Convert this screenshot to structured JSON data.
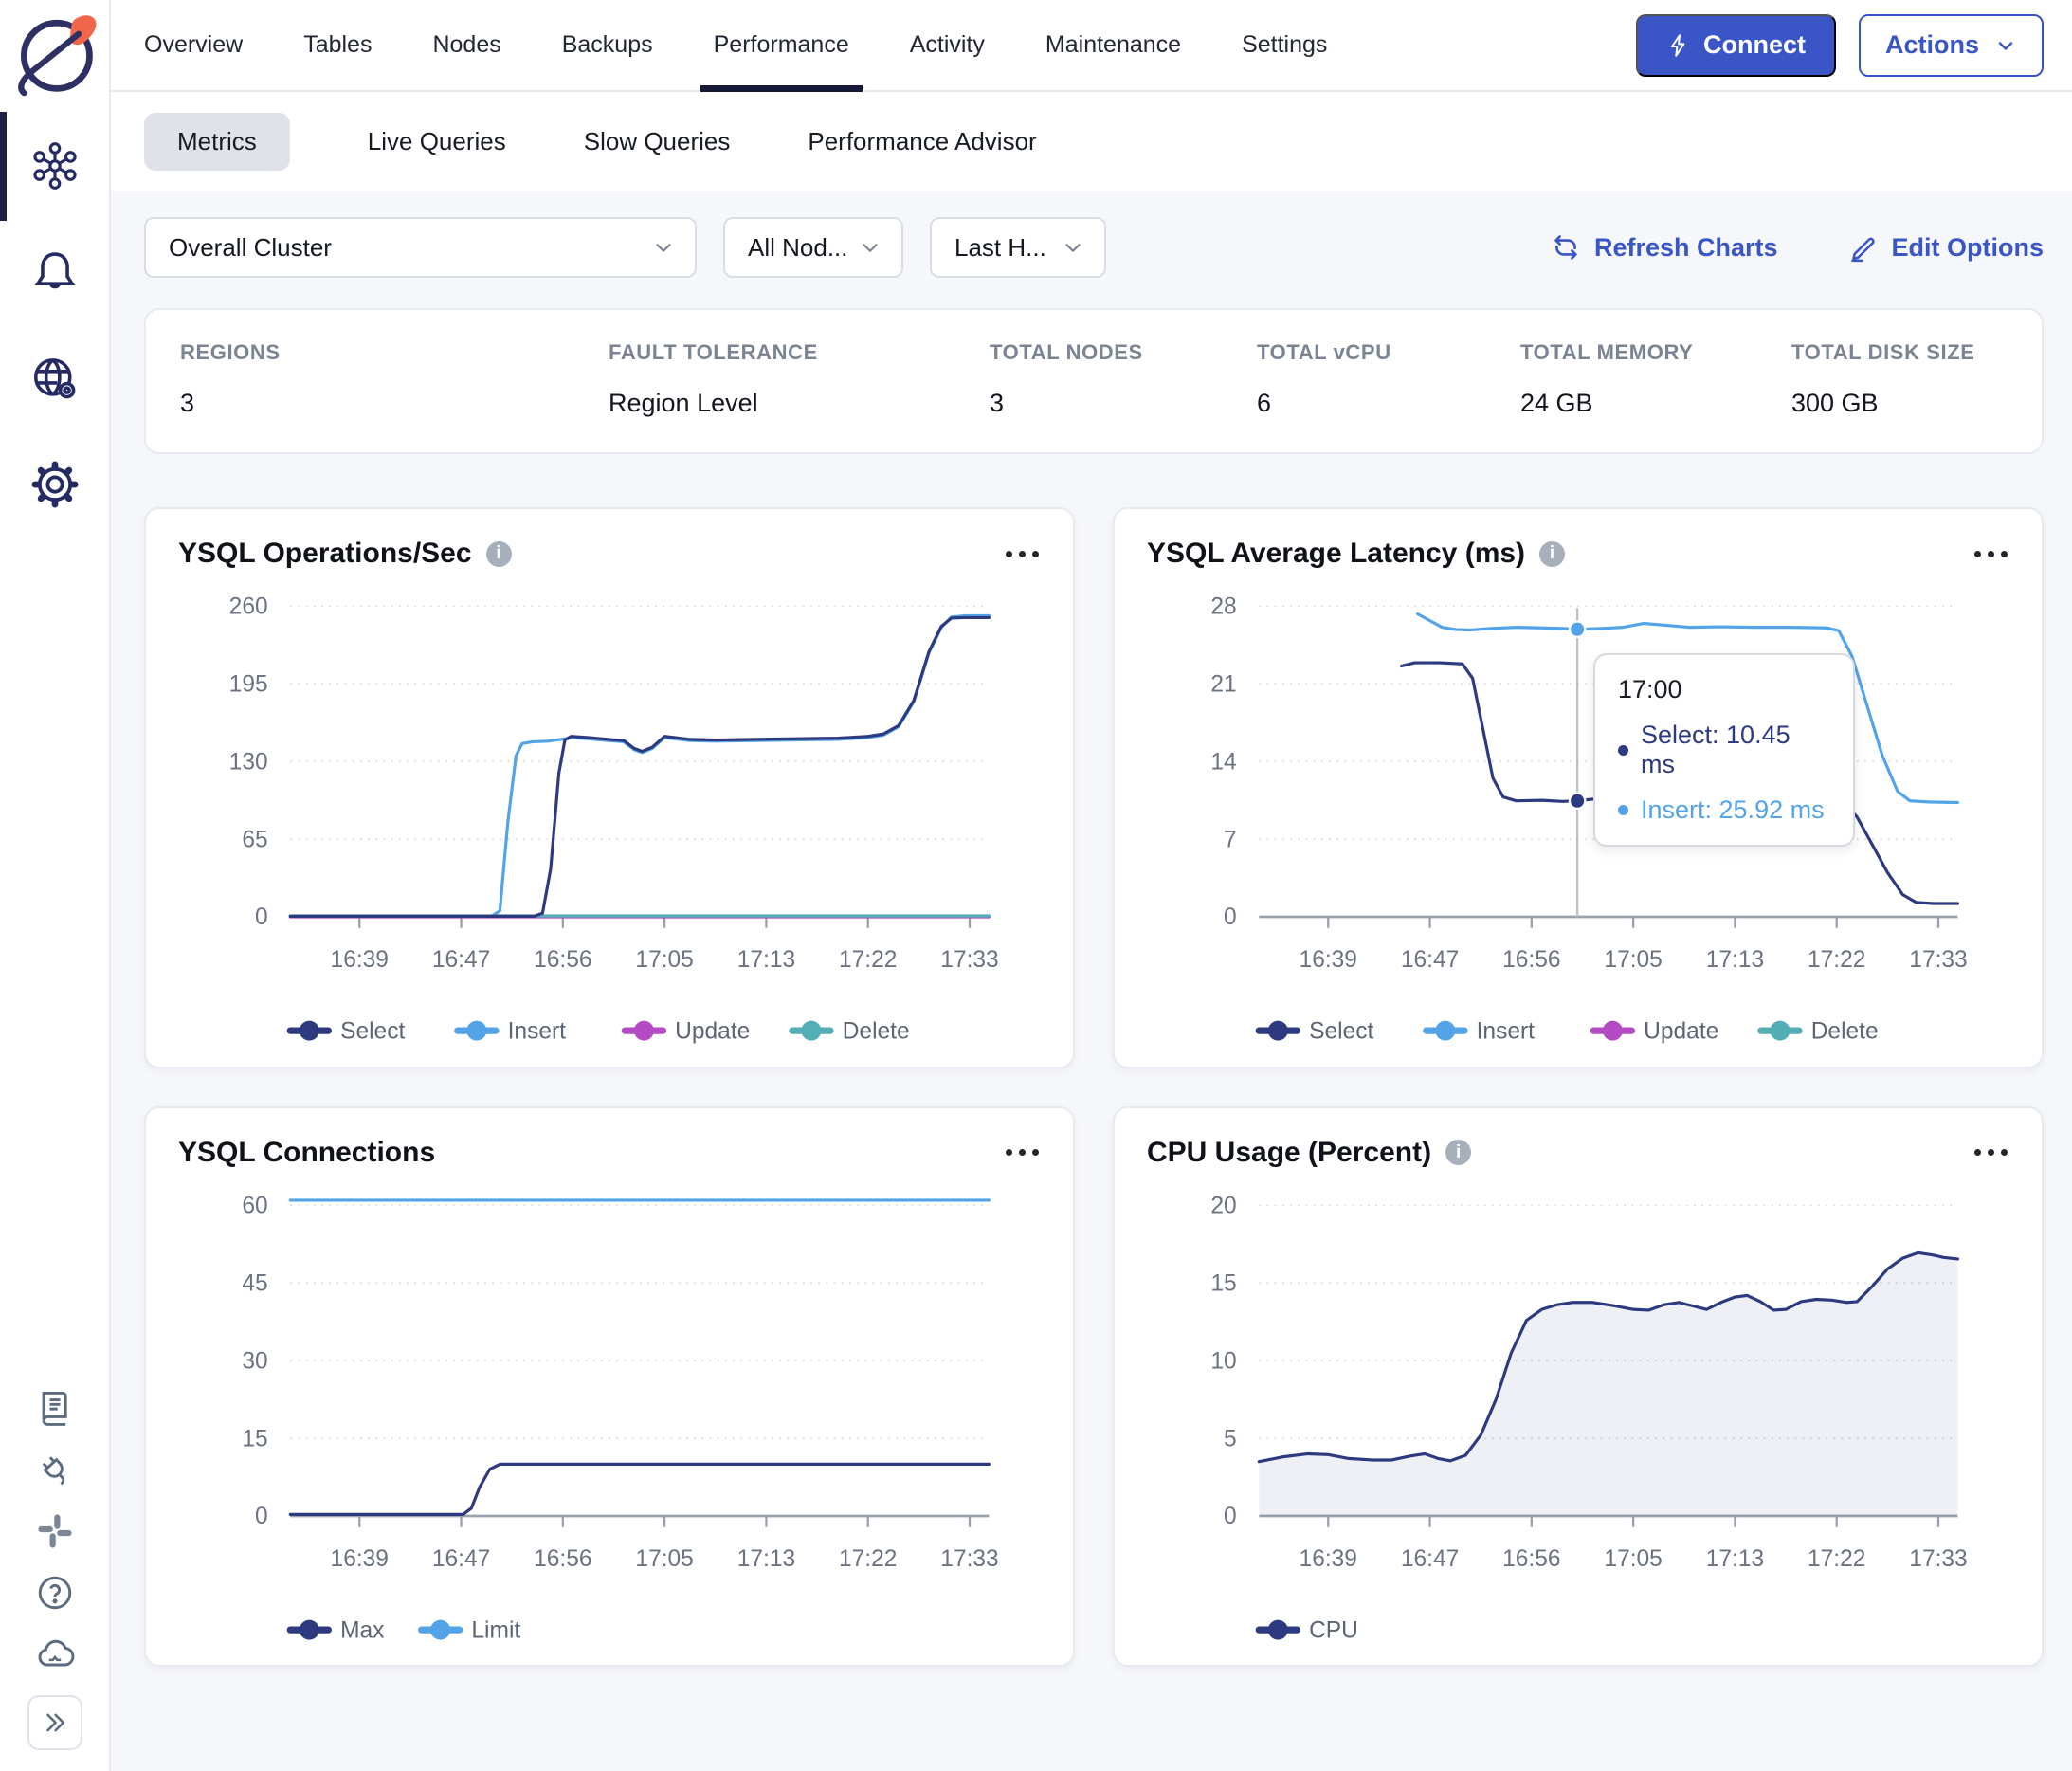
{
  "nav": {
    "tabs": [
      "Overview",
      "Tables",
      "Nodes",
      "Backups",
      "Performance",
      "Activity",
      "Maintenance",
      "Settings"
    ],
    "active_tab": "Performance",
    "connect_label": "Connect",
    "actions_label": "Actions"
  },
  "subnav": {
    "tabs": [
      "Metrics",
      "Live Queries",
      "Slow Queries",
      "Performance Advisor"
    ],
    "active_tab": "Metrics"
  },
  "filters": {
    "cluster": "Overall Cluster",
    "nodes": "All Nod...",
    "range": "Last H...",
    "refresh_label": "Refresh Charts",
    "edit_label": "Edit Options"
  },
  "stats": [
    {
      "label": "REGIONS",
      "value": "3"
    },
    {
      "label": "FAULT TOLERANCE",
      "value": "Region Level"
    },
    {
      "label": "TOTAL NODES",
      "value": "3"
    },
    {
      "label": "TOTAL vCPU",
      "value": "6"
    },
    {
      "label": "TOTAL MEMORY",
      "value": "24 GB"
    },
    {
      "label": "TOTAL DISK SIZE",
      "value": "300 GB"
    }
  ],
  "colors": {
    "accent_blue": "#3a55c5",
    "series_navy": "#2d3a80",
    "series_blue": "#52a3e8",
    "series_magenta": "#b44bc4",
    "series_teal": "#53aeb5",
    "active_tab_underline": "#161a38"
  },
  "chart_data": [
    {
      "type": "line",
      "title": "YSQL Operations/Sec",
      "has_info": true,
      "ylim": [
        0,
        260
      ],
      "yticks": [
        0,
        65,
        130,
        195,
        260
      ],
      "xticks": [
        "16:39",
        "16:47",
        "16:56",
        "17:05",
        "17:13",
        "17:22",
        "17:33"
      ],
      "xdomain": [
        -0.68,
        6.19
      ],
      "legend": [
        {
          "label": "Select",
          "color": "#2d3a80"
        },
        {
          "label": "Insert",
          "color": "#52a3e8"
        },
        {
          "label": "Update",
          "color": "#b44bc4"
        },
        {
          "label": "Delete",
          "color": "#53aeb5"
        }
      ],
      "series": [
        {
          "name": "Update",
          "color": "#b44bc4",
          "points": [
            [
              -0.68,
              0
            ],
            [
              6.19,
              0
            ]
          ]
        },
        {
          "name": "Delete",
          "color": "#53aeb5",
          "points": [
            [
              -0.68,
              0.8
            ],
            [
              6.19,
              0.8
            ]
          ]
        },
        {
          "name": "Insert",
          "color": "#52a3e8",
          "points": [
            [
              -0.68,
              0.5
            ],
            [
              1.3,
              0.5
            ],
            [
              1.38,
              5
            ],
            [
              1.46,
              80
            ],
            [
              1.54,
              135
            ],
            [
              1.6,
              145
            ],
            [
              1.7,
              146.5
            ],
            [
              1.85,
              147
            ],
            [
              2.02,
              149
            ],
            [
              2.1,
              150
            ],
            [
              2.25,
              149
            ],
            [
              2.45,
              147.5
            ],
            [
              2.6,
              146.5
            ],
            [
              2.7,
              140
            ],
            [
              2.78,
              137.5
            ],
            [
              2.88,
              141
            ],
            [
              3.0,
              150
            ],
            [
              3.1,
              149
            ],
            [
              3.25,
              147.5
            ],
            [
              3.5,
              147
            ],
            [
              3.9,
              147.5
            ],
            [
              4.3,
              148
            ],
            [
              4.7,
              148.5
            ],
            [
              5.0,
              150
            ],
            [
              5.15,
              152
            ],
            [
              5.3,
              159
            ],
            [
              5.45,
              180
            ],
            [
              5.6,
              221
            ],
            [
              5.72,
              242
            ],
            [
              5.82,
              251
            ],
            [
              5.95,
              252
            ],
            [
              6.19,
              252
            ]
          ]
        },
        {
          "name": "Select",
          "color": "#2d3a80",
          "points": [
            [
              -0.68,
              0.5
            ],
            [
              1.72,
              0.5
            ],
            [
              1.8,
              3
            ],
            [
              1.88,
              40
            ],
            [
              1.96,
              120
            ],
            [
              2.02,
              148
            ],
            [
              2.08,
              151
            ],
            [
              2.25,
              150
            ],
            [
              2.45,
              148.5
            ],
            [
              2.6,
              147.5
            ],
            [
              2.7,
              141
            ],
            [
              2.78,
              138.5
            ],
            [
              2.88,
              142
            ],
            [
              3.0,
              151
            ],
            [
              3.1,
              150
            ],
            [
              3.25,
              148.5
            ],
            [
              3.5,
              148
            ],
            [
              3.9,
              148.5
            ],
            [
              4.3,
              149
            ],
            [
              4.7,
              149.5
            ],
            [
              5.0,
              151
            ],
            [
              5.15,
              153
            ],
            [
              5.3,
              160
            ],
            [
              5.45,
              181
            ],
            [
              5.6,
              222
            ],
            [
              5.72,
              243
            ],
            [
              5.82,
              250
            ],
            [
              5.95,
              250.5
            ],
            [
              6.19,
              250.5
            ]
          ]
        }
      ]
    },
    {
      "type": "line",
      "title": "YSQL Average Latency (ms)",
      "has_info": true,
      "ylim": [
        0,
        28
      ],
      "yticks": [
        0,
        7,
        14,
        21,
        28
      ],
      "xticks": [
        "16:39",
        "16:47",
        "16:56",
        "17:05",
        "17:13",
        "17:22",
        "17:33"
      ],
      "xdomain": [
        -0.68,
        6.19
      ],
      "legend": [
        {
          "label": "Select",
          "color": "#2d3a80"
        },
        {
          "label": "Insert",
          "color": "#52a3e8"
        },
        {
          "label": "Update",
          "color": "#b44bc4"
        },
        {
          "label": "Delete",
          "color": "#53aeb5"
        }
      ],
      "series": [
        {
          "name": "Select",
          "color": "#2d3a80",
          "points": [
            [
              0.72,
              22.6
            ],
            [
              0.85,
              22.9
            ],
            [
              1.1,
              22.9
            ],
            [
              1.32,
              22.8
            ],
            [
              1.42,
              21.5
            ],
            [
              1.52,
              17
            ],
            [
              1.62,
              12.5
            ],
            [
              1.72,
              10.8
            ],
            [
              1.85,
              10.45
            ],
            [
              2.1,
              10.5
            ],
            [
              2.3,
              10.4
            ],
            [
              2.45,
              10.45
            ],
            [
              2.6,
              10.6
            ],
            [
              2.75,
              10.5
            ],
            [
              2.9,
              10.4
            ],
            [
              3.05,
              10.6
            ],
            [
              3.2,
              11.0
            ],
            [
              3.35,
              10.7
            ],
            [
              3.55,
              10.45
            ],
            [
              3.8,
              10.4
            ],
            [
              4.1,
              10.45
            ],
            [
              4.4,
              10.4
            ],
            [
              4.7,
              10.45
            ],
            [
              4.95,
              10.5
            ],
            [
              5.08,
              10.2
            ],
            [
              5.2,
              9
            ],
            [
              5.35,
              6.5
            ],
            [
              5.5,
              4
            ],
            [
              5.65,
              2
            ],
            [
              5.78,
              1.3
            ],
            [
              5.95,
              1.2
            ],
            [
              6.19,
              1.2
            ]
          ]
        },
        {
          "name": "Insert",
          "color": "#52a3e8",
          "points": [
            [
              0.88,
              27.3
            ],
            [
              1.0,
              26.7
            ],
            [
              1.12,
              26.1
            ],
            [
              1.25,
              25.9
            ],
            [
              1.4,
              25.85
            ],
            [
              1.6,
              26.0
            ],
            [
              1.85,
              26.1
            ],
            [
              2.1,
              26.05
            ],
            [
              2.3,
              26.0
            ],
            [
              2.45,
              25.92
            ],
            [
              2.7,
              26.0
            ],
            [
              2.9,
              26.1
            ],
            [
              3.1,
              26.45
            ],
            [
              3.3,
              26.3
            ],
            [
              3.55,
              26.1
            ],
            [
              3.85,
              26.15
            ],
            [
              4.2,
              26.1
            ],
            [
              4.55,
              26.1
            ],
            [
              4.9,
              26.05
            ],
            [
              5.02,
              25.8
            ],
            [
              5.15,
              23.5
            ],
            [
              5.3,
              19
            ],
            [
              5.45,
              14.5
            ],
            [
              5.6,
              11.3
            ],
            [
              5.72,
              10.45
            ],
            [
              5.9,
              10.35
            ],
            [
              6.19,
              10.3
            ]
          ]
        }
      ],
      "crosshair": {
        "x": 2.45,
        "points": [
          {
            "y": 25.92,
            "color": "#52a3e8"
          },
          {
            "y": 10.45,
            "color": "#2d3a80"
          }
        ]
      },
      "tooltip": {
        "time": "17:00",
        "rows": [
          {
            "label": "Select: 10.45 ms",
            "color": "#2d3a80"
          },
          {
            "label": "Insert: 25.92 ms",
            "color": "#52a3e8"
          }
        ]
      }
    },
    {
      "type": "line",
      "title": "YSQL Connections",
      "has_info": false,
      "ylim": [
        0,
        60
      ],
      "yticks": [
        0,
        15,
        30,
        45,
        60
      ],
      "xticks": [
        "16:39",
        "16:47",
        "16:56",
        "17:05",
        "17:13",
        "17:22",
        "17:33"
      ],
      "xdomain": [
        -0.68,
        6.19
      ],
      "legend": [
        {
          "label": "Max",
          "color": "#2d3a80"
        },
        {
          "label": "Limit",
          "color": "#52a3e8"
        }
      ],
      "series": [
        {
          "name": "Limit",
          "color": "#52a3e8",
          "points": [
            [
              -0.68,
              61
            ],
            [
              6.19,
              61
            ]
          ]
        },
        {
          "name": "Max",
          "color": "#2d3a80",
          "points": [
            [
              -0.68,
              0.3
            ],
            [
              1.02,
              0.3
            ],
            [
              1.1,
              1.5
            ],
            [
              1.18,
              5.5
            ],
            [
              1.28,
              9
            ],
            [
              1.38,
              10
            ],
            [
              6.19,
              10
            ]
          ]
        }
      ]
    },
    {
      "type": "area",
      "title": "CPU Usage (Percent)",
      "has_info": true,
      "ylim": [
        0,
        20
      ],
      "yticks": [
        0,
        5,
        10,
        15,
        20
      ],
      "xticks": [
        "16:39",
        "16:47",
        "16:56",
        "17:05",
        "17:13",
        "17:22",
        "17:33"
      ],
      "xdomain": [
        -0.68,
        6.19
      ],
      "legend": [
        {
          "label": "CPU",
          "color": "#2d3a80"
        }
      ],
      "series": [
        {
          "name": "CPU",
          "color": "#2d3a80",
          "area": true,
          "points": [
            [
              -0.68,
              3.5
            ],
            [
              -0.45,
              3.8
            ],
            [
              -0.2,
              4.0
            ],
            [
              0.0,
              3.95
            ],
            [
              0.2,
              3.7
            ],
            [
              0.45,
              3.6
            ],
            [
              0.62,
              3.6
            ],
            [
              0.8,
              3.85
            ],
            [
              0.95,
              4.0
            ],
            [
              1.08,
              3.7
            ],
            [
              1.2,
              3.55
            ],
            [
              1.35,
              3.9
            ],
            [
              1.5,
              5.2
            ],
            [
              1.65,
              7.5
            ],
            [
              1.8,
              10.5
            ],
            [
              1.95,
              12.6
            ],
            [
              2.1,
              13.3
            ],
            [
              2.25,
              13.6
            ],
            [
              2.4,
              13.75
            ],
            [
              2.6,
              13.75
            ],
            [
              2.8,
              13.55
            ],
            [
              3.0,
              13.3
            ],
            [
              3.15,
              13.25
            ],
            [
              3.3,
              13.6
            ],
            [
              3.45,
              13.75
            ],
            [
              3.6,
              13.5
            ],
            [
              3.72,
              13.3
            ],
            [
              3.88,
              13.8
            ],
            [
              4.0,
              14.1
            ],
            [
              4.12,
              14.2
            ],
            [
              4.25,
              13.8
            ],
            [
              4.38,
              13.25
            ],
            [
              4.5,
              13.3
            ],
            [
              4.65,
              13.8
            ],
            [
              4.8,
              13.95
            ],
            [
              4.95,
              13.9
            ],
            [
              5.1,
              13.75
            ],
            [
              5.2,
              13.8
            ],
            [
              5.35,
              14.8
            ],
            [
              5.5,
              15.9
            ],
            [
              5.65,
              16.6
            ],
            [
              5.8,
              16.95
            ],
            [
              5.95,
              16.8
            ],
            [
              6.05,
              16.65
            ],
            [
              6.19,
              16.55
            ]
          ]
        }
      ]
    }
  ]
}
